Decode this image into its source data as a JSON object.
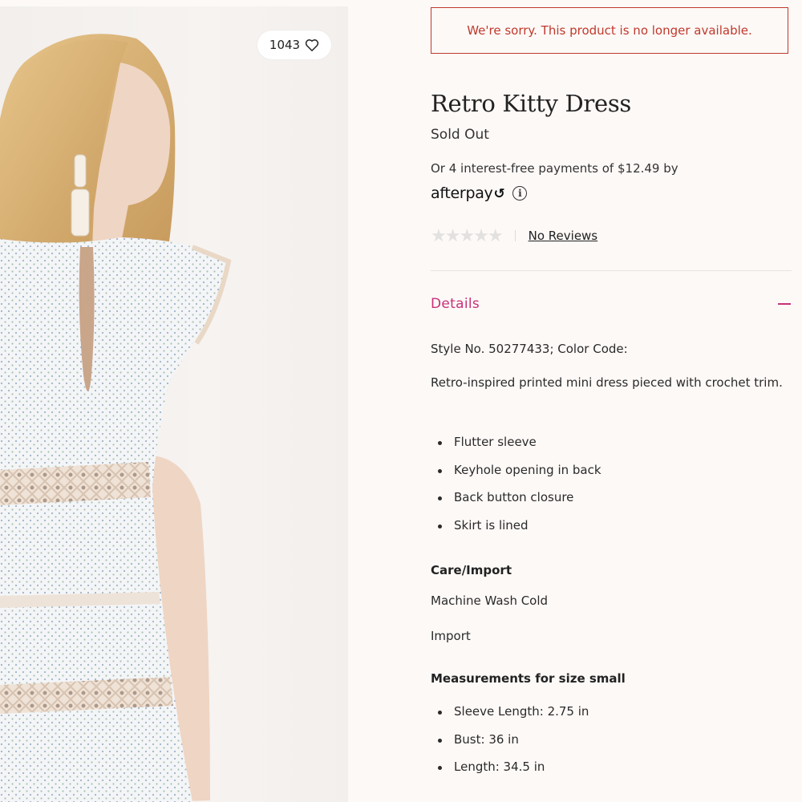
{
  "product": {
    "likes_count": "1043",
    "unavailable_message": "We're sorry. This product is no longer available.",
    "title": "Retro Kitty Dress",
    "status": "Sold Out",
    "afterpay_text": "Or 4 interest-free payments of $12.49 by",
    "afterpay_logo": "afterpay",
    "rating_stars": "★★★★★",
    "rating_value": 0,
    "reviews_link": "No Reviews"
  },
  "details": {
    "header": "Details",
    "style_line": "Style No. 50277433; Color Code:",
    "description": "Retro-inspired printed mini dress pieced with crochet trim.",
    "features": [
      "Flutter sleeve",
      "Keyhole opening in back",
      "Back button closure",
      "Skirt is lined"
    ],
    "care_heading": "Care/Import",
    "care": [
      "Machine Wash Cold",
      "Import"
    ],
    "measurements_heading": "Measurements for size small",
    "measurements": [
      "Sleeve Length: 2.75 in",
      "Bust: 36 in",
      "Length: 34.5 in"
    ]
  },
  "colors": {
    "alert": "#c0392b",
    "accent": "#c8307a",
    "background": "#fdf9f7"
  },
  "icons": [
    "heart-icon",
    "info-icon",
    "collapse-icon"
  ]
}
